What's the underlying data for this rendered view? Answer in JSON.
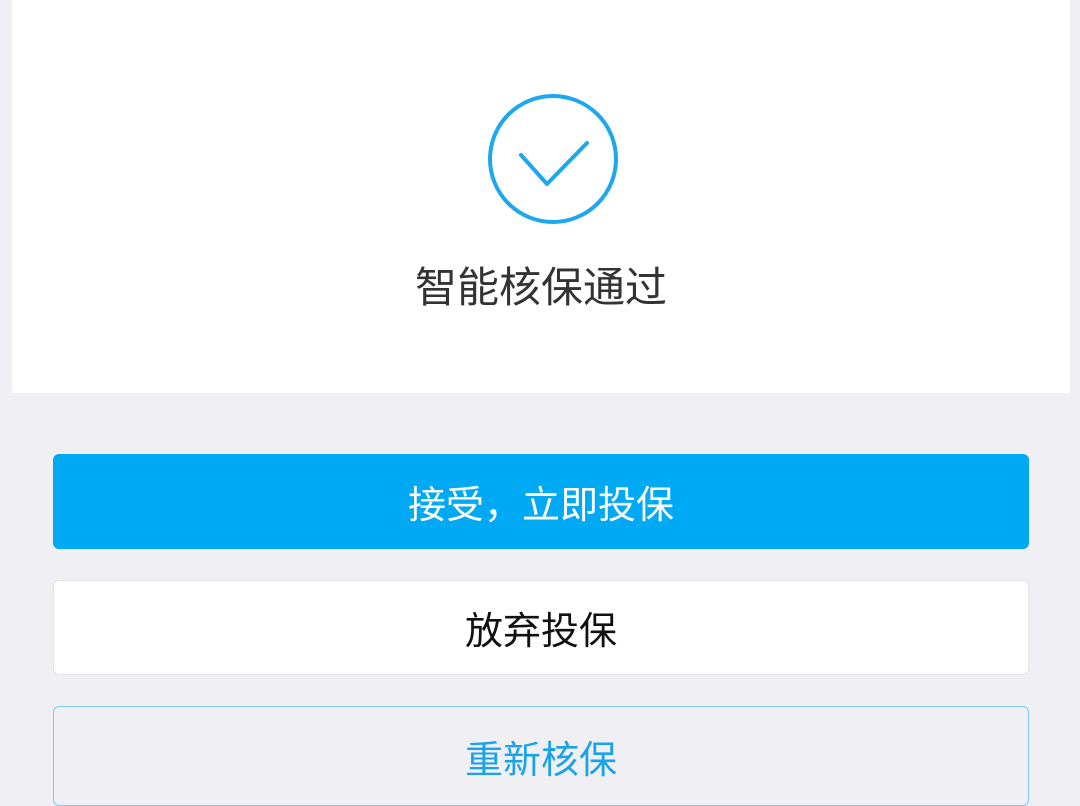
{
  "result": {
    "title": "智能核保通过",
    "icon": "check-circle-icon",
    "accent_color": "#1da8ee"
  },
  "actions": {
    "accept_label": "接受，立即投保",
    "abandon_label": "放弃投保",
    "retry_label": "重新核保"
  },
  "colors": {
    "primary": "#00a9f4",
    "page_background": "#efeff4",
    "card_background": "#ffffff",
    "outline_text": "#1aa3e8"
  }
}
